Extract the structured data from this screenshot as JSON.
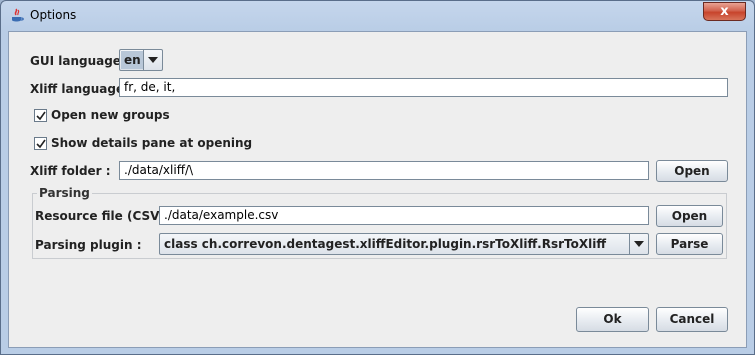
{
  "window": {
    "title": "Options"
  },
  "gui_language": {
    "label": "GUI language",
    "value": "en"
  },
  "xliff_languages": {
    "label": "Xliff languages",
    "value": "fr, de, it,"
  },
  "open_new_groups": {
    "label": "Open new groups",
    "checked": true
  },
  "show_details": {
    "label": "Show details pane at opening",
    "checked": true
  },
  "xliff_folder": {
    "label": "Xliff folder :",
    "value": "./data/xliff/\\",
    "open_label": "Open"
  },
  "parsing": {
    "title": "Parsing",
    "resource_label": "Resource file (CSV) :",
    "resource_value": "./data/example.csv",
    "resource_open_label": "Open",
    "plugin_label": "Parsing plugin :",
    "plugin_value": "class ch.correvon.dentagest.xliffEditor.plugin.rsrToXliff.RsrToXliff",
    "parse_label": "Parse"
  },
  "buttons": {
    "ok": "Ok",
    "cancel": "Cancel"
  },
  "close_glyph": "x"
}
